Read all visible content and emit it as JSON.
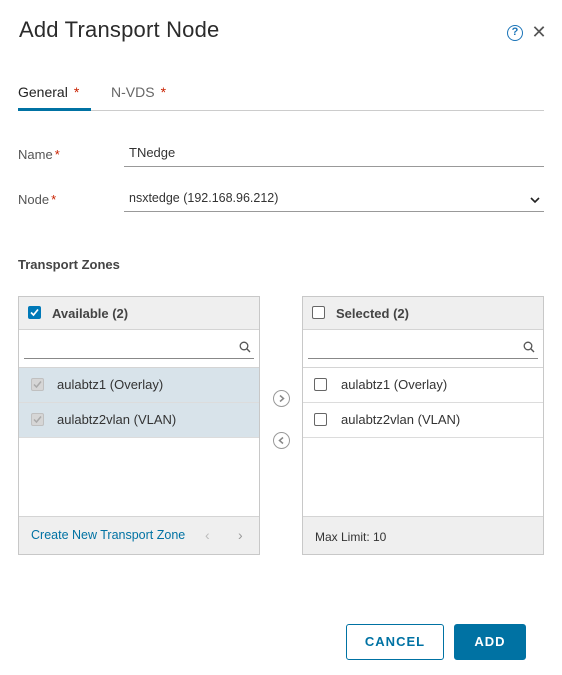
{
  "dialog": {
    "title": "Add Transport Node",
    "help_glyph": "?",
    "close_glyph": "✕"
  },
  "tabs": [
    {
      "label": "General",
      "required": "*",
      "active": true
    },
    {
      "label": "N-VDS",
      "required": "*",
      "active": false
    }
  ],
  "form": {
    "name_label": "Name",
    "name_required": "*",
    "name_value": "TNedge",
    "node_label": "Node",
    "node_required": "*",
    "node_value": "nsxtedge (192.168.96.212)"
  },
  "transport_zones": {
    "section_title": "Transport Zones",
    "available": {
      "header": "Available (2)",
      "search_placeholder": "",
      "items": [
        {
          "label": "aulabtz1 (Overlay)",
          "selected": true
        },
        {
          "label": "aulabtz2vlan (VLAN)",
          "selected": true
        }
      ],
      "create_link": "Create New Transport Zone",
      "prev_glyph": "‹",
      "next_glyph": "›"
    },
    "selected": {
      "header": "Selected (2)",
      "search_placeholder": "",
      "items": [
        {
          "label": "aulabtz1 (Overlay)"
        },
        {
          "label": "aulabtz2vlan (VLAN)"
        }
      ],
      "footer_text": "Max Limit: 10"
    }
  },
  "actions": {
    "cancel_label": "CANCEL",
    "add_label": "ADD"
  },
  "colors": {
    "accent": "#0072a3",
    "required": "#c92100",
    "selected_row": "#d8e3ea",
    "footer_bg": "#efefef"
  },
  "icons": [
    "help-icon",
    "close-icon",
    "chevron-down-icon",
    "search-icon",
    "arrow-right-icon",
    "arrow-left-icon"
  ]
}
